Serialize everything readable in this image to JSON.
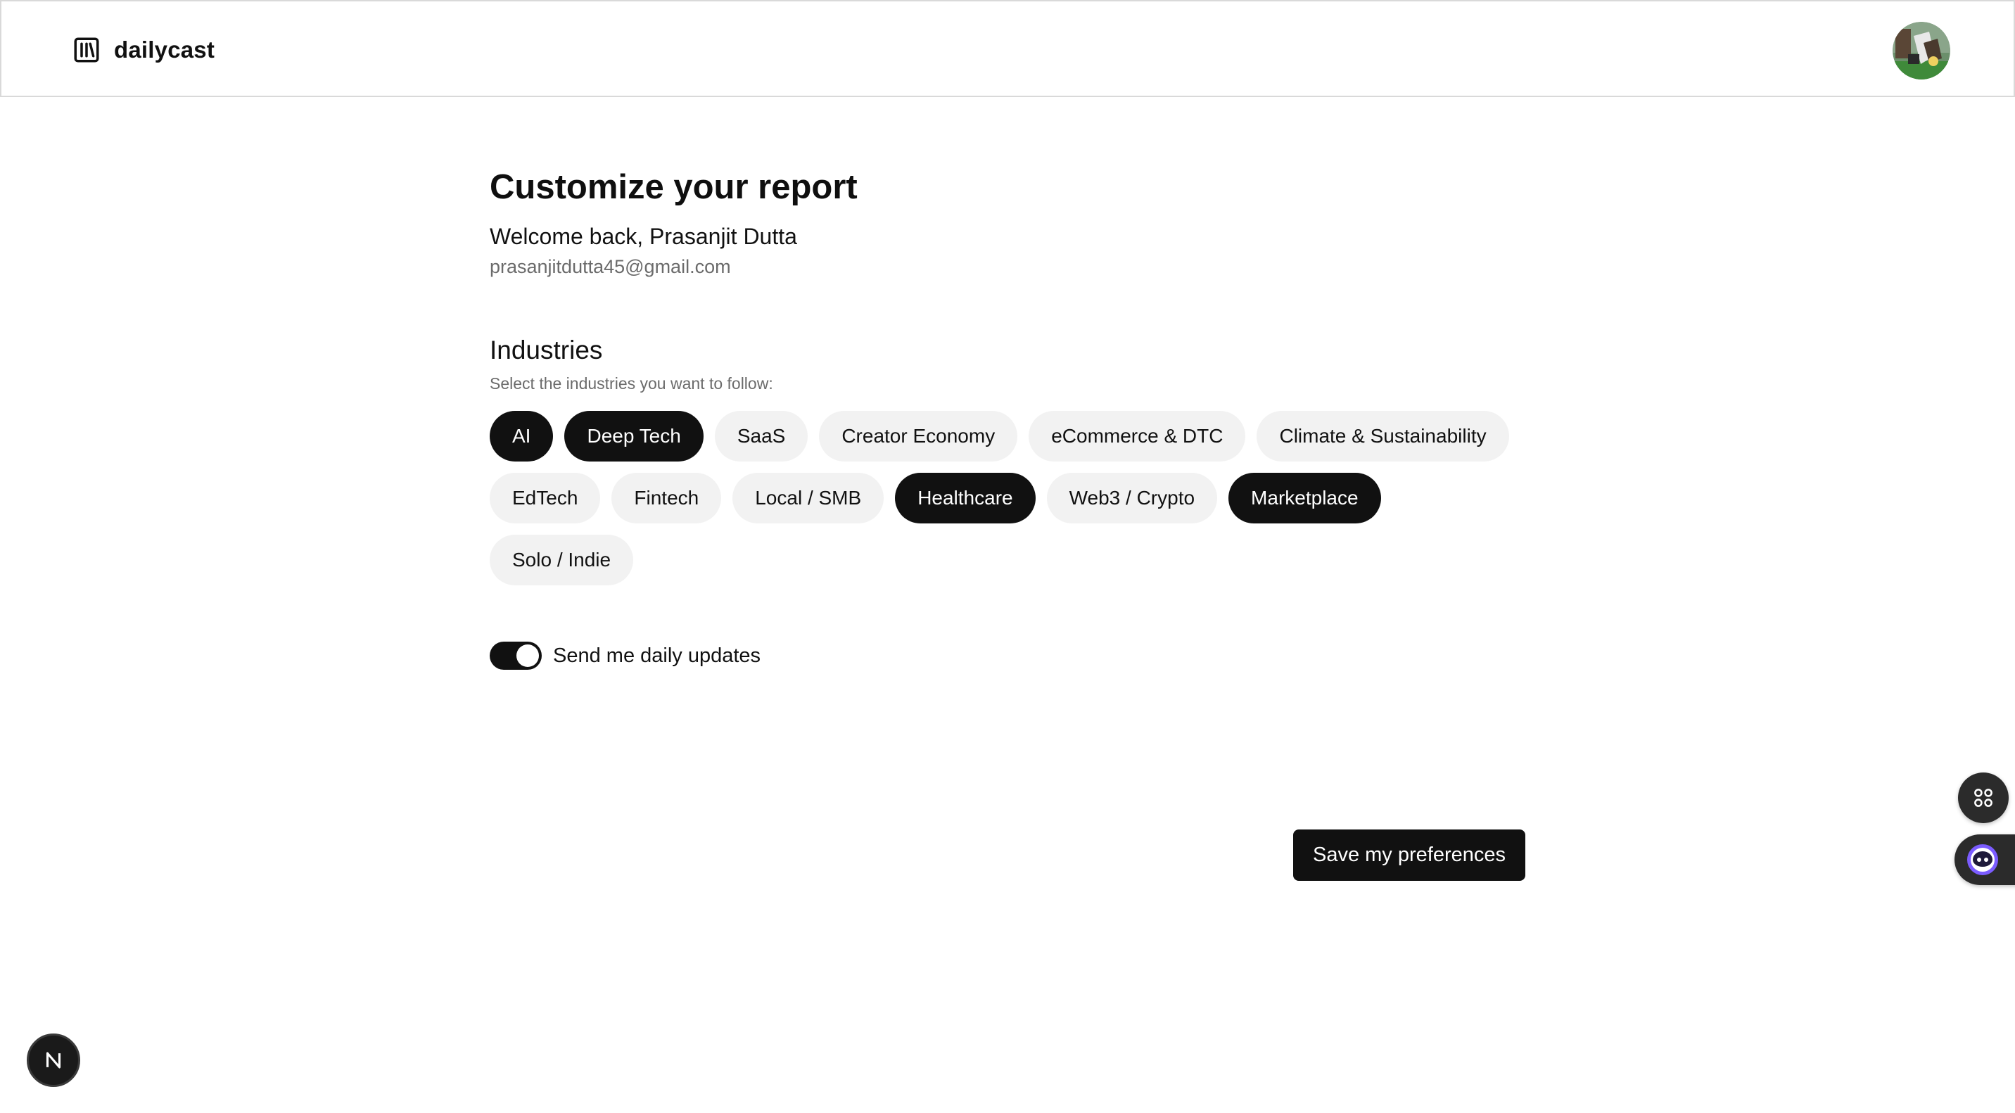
{
  "header": {
    "brand_name": "dailycast",
    "brand_icon": "library-icon",
    "avatar_icon": "user-avatar"
  },
  "main": {
    "title": "Customize your report",
    "welcome": "Welcome back, Prasanjit Dutta",
    "email": "prasanjitdutta45@gmail.com",
    "industries": {
      "title": "Industries",
      "subtitle": "Select the industries you want to follow:",
      "items": [
        {
          "label": "AI",
          "selected": true
        },
        {
          "label": "Deep Tech",
          "selected": true
        },
        {
          "label": "SaaS",
          "selected": false
        },
        {
          "label": "Creator Economy",
          "selected": false
        },
        {
          "label": "eCommerce & DTC",
          "selected": false
        },
        {
          "label": "Climate & Sustainability",
          "selected": false
        },
        {
          "label": "EdTech",
          "selected": false
        },
        {
          "label": "Fintech",
          "selected": false
        },
        {
          "label": "Local / SMB",
          "selected": false
        },
        {
          "label": "Healthcare",
          "selected": true
        },
        {
          "label": "Web3 / Crypto",
          "selected": false
        },
        {
          "label": "Marketplace",
          "selected": true
        },
        {
          "label": "Solo / Indie",
          "selected": false
        }
      ]
    },
    "daily_updates": {
      "label": "Send me daily updates",
      "enabled": true
    },
    "save_label": "Save my preferences"
  },
  "widgets": {
    "grid_icon": "command-grid-icon",
    "assistant_icon": "assistant-bot-icon",
    "next_badge_letter": "N"
  },
  "colors": {
    "primary": "#111111",
    "chip_bg": "#f2f2f2",
    "muted_text": "#6b6b6b",
    "border": "#d9d9d9",
    "assistant_accent": "#7b5cff"
  }
}
